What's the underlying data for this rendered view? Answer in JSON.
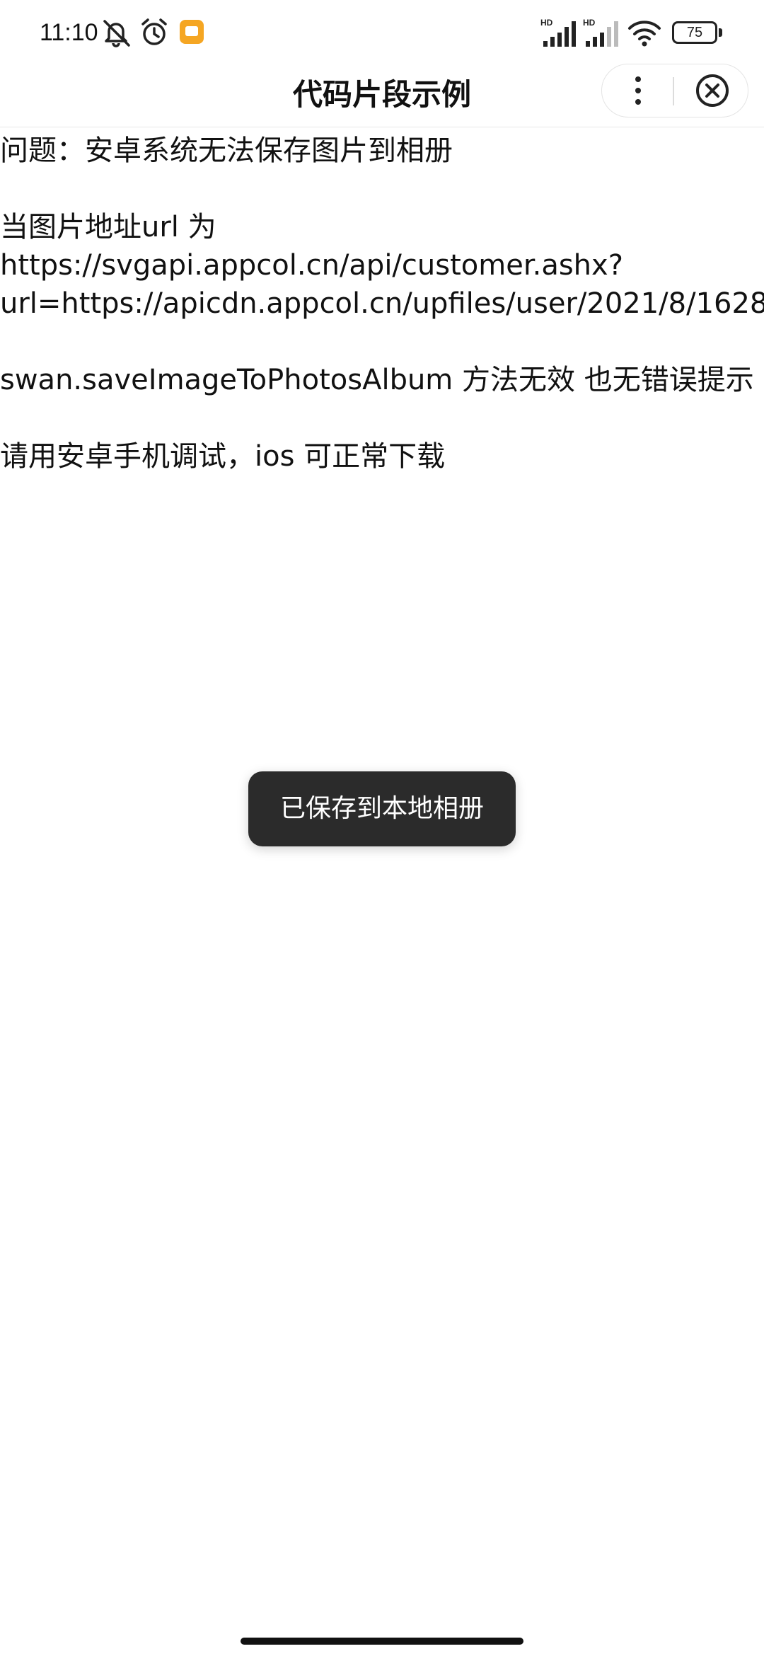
{
  "status_bar": {
    "time": "11:10",
    "battery_level": "75",
    "icons": [
      "mute-icon",
      "alarm-icon",
      "notification-app-icon",
      "hd-signal-icon",
      "hd-signal-icon",
      "wifi-icon",
      "battery-icon"
    ],
    "signal_label_1": "HD",
    "signal_label_2": "HD"
  },
  "nav": {
    "title": "代码片段示例",
    "more_icon": "more-vertical-icon",
    "close_icon": "close-circle-icon"
  },
  "content": {
    "line1": "问题：安卓系统无法保存图片到相册",
    "line2_label": "当图片地址url 为",
    "line2_url_a": "https://svgapi.appcol.cn/api/customer.ashx?",
    "line2_url_b": "url=https://apicdn.appcol.cn/upfiles/user/2021/8/1628",
    "line3": "swan.saveImageToPhotosAlbum 方法无效 也无错误提示",
    "line4": "请用安卓手机调试，ios 可正常下载"
  },
  "toast": {
    "message": "已保存到本地相册"
  },
  "colors": {
    "toast_bg": "#2b2b2b",
    "app_icon": "#f5a623"
  }
}
